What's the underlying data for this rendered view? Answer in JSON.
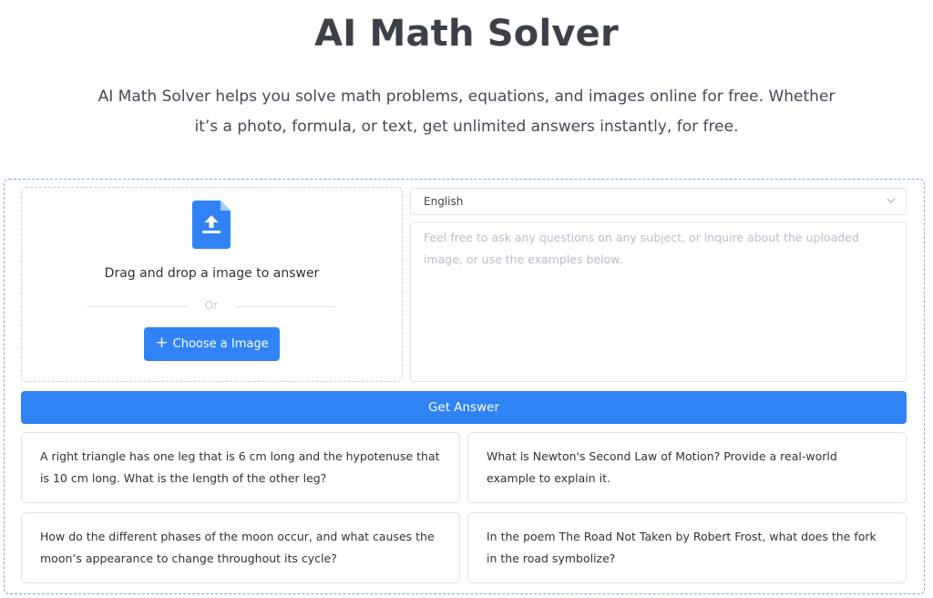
{
  "header": {
    "title": "AI Math Solver",
    "subtitle": "AI Math Solver helps you solve math problems, equations, and images online for free. Whether it’s a photo, formula, or text, get unlimited answers instantly, for free."
  },
  "upload": {
    "icon": "file-upload-icon",
    "drop_text": "Drag and drop a image to answer",
    "or_text": "Or",
    "choose_label": "Choose a Image"
  },
  "language": {
    "selected": "English",
    "icon": "chevron-down-icon"
  },
  "question": {
    "placeholder": "Feel free to ask any questions on any subject, or inquire about the uploaded image, or use the examples below.",
    "value": ""
  },
  "submit": {
    "label": "Get Answer"
  },
  "examples": [
    "A right triangle has one leg that is 6 cm long and the hypotenuse that is 10 cm long. What is the length of the other leg?",
    "What is Newton's Second Law of Motion? Provide a real-world example to explain it.",
    "How do the different phases of the moon occur, and what causes the moon’s appearance to change throughout its cycle?",
    "In the poem The Road Not Taken by Robert Frost, what does the fork in the road symbolize?"
  ],
  "colors": {
    "accent": "#2f83f5",
    "title": "#3c4149",
    "border": "#dde2e8",
    "dashed_outline": "#7fa9dc"
  }
}
